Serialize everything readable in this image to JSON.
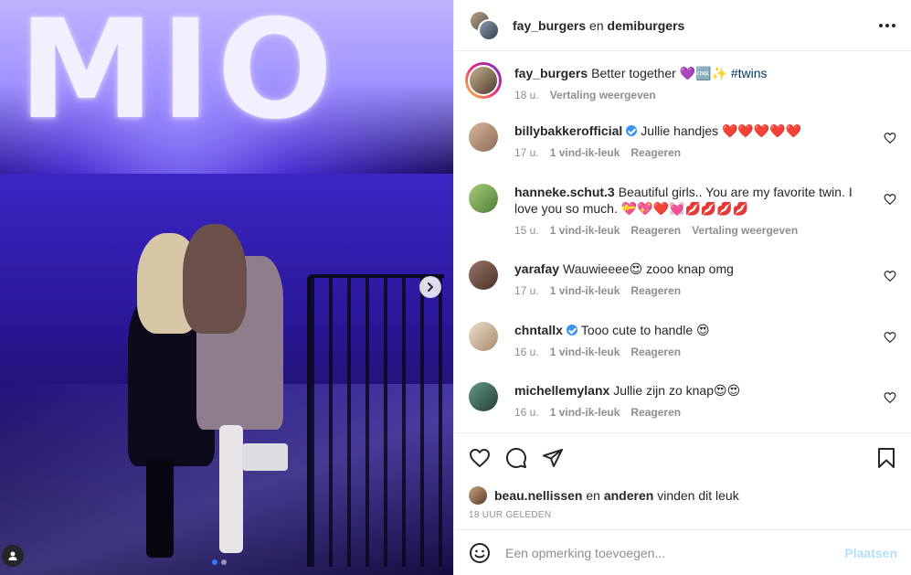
{
  "header": {
    "user1": "fay_burgers",
    "connector": "en",
    "user2": "demiburgers",
    "more_icon": "more-horizontal-icon"
  },
  "photo": {
    "sign_text": "MIO",
    "next_icon": "chevron-right-icon",
    "tag_icon": "user-tag-icon",
    "carousel_count": 2,
    "carousel_active": 1
  },
  "caption": {
    "user": "fay_burgers",
    "text": "Better together 💜🆒✨",
    "hashtag": "#twins",
    "time": "18 u.",
    "translate": "Vertaling weergeven"
  },
  "comments": [
    {
      "user": "billybakkerofficial",
      "verified": true,
      "text": "Jullie handjes ❤️❤️❤️❤️❤️",
      "time": "17 u.",
      "likes": "1 vind-ik-leuk",
      "reply": "Reageren",
      "translate": "",
      "avatar_color": "#c9a58a"
    },
    {
      "user": "hanneke.schut.3",
      "verified": false,
      "text": "Beautiful girls.. You are my favorite twin. I love you so much. 💝💖❤️💓💋💋💋💋",
      "time": "15 u.",
      "likes": "1 vind-ik-leuk",
      "reply": "Reageren",
      "translate": "Vertaling weergeven",
      "avatar_color": "#8fbf6a"
    },
    {
      "user": "yarafay",
      "verified": false,
      "text": "Wauwieeee😍 zooo knap omg",
      "time": "17 u.",
      "likes": "1 vind-ik-leuk",
      "reply": "Reageren",
      "translate": "",
      "avatar_color": "#7a5a4a"
    },
    {
      "user": "chntallx",
      "verified": true,
      "text": "Tooo cute to handle 😍",
      "time": "16 u.",
      "likes": "1 vind-ik-leuk",
      "reply": "Reageren",
      "translate": "",
      "avatar_color": "#d9c3a8"
    },
    {
      "user": "michellemylanx",
      "verified": false,
      "text": "Jullie zijn zo knap😍😍",
      "time": "16 u.",
      "likes": "1 vind-ik-leuk",
      "reply": "Reageren",
      "translate": "",
      "avatar_color": "#3b6d5e"
    }
  ],
  "actions": {
    "like_icon": "heart-icon",
    "comment_icon": "comment-icon",
    "share_icon": "paper-plane-icon",
    "save_icon": "bookmark-icon"
  },
  "likes": {
    "user": "beau.nellissen",
    "connector": "en",
    "others": "anderen",
    "suffix": "vinden dit leuk"
  },
  "timestamp": "18 UUR GELEDEN",
  "composer": {
    "emoji_icon": "smiley-icon",
    "placeholder": "Een opmerking toevoegen...",
    "post_label": "Plaatsen"
  },
  "colors": {
    "verified": "#3897f0",
    "post_disabled": "#b2dffc",
    "muted": "#8e8e8e",
    "carousel_active": "#2f7bff"
  }
}
